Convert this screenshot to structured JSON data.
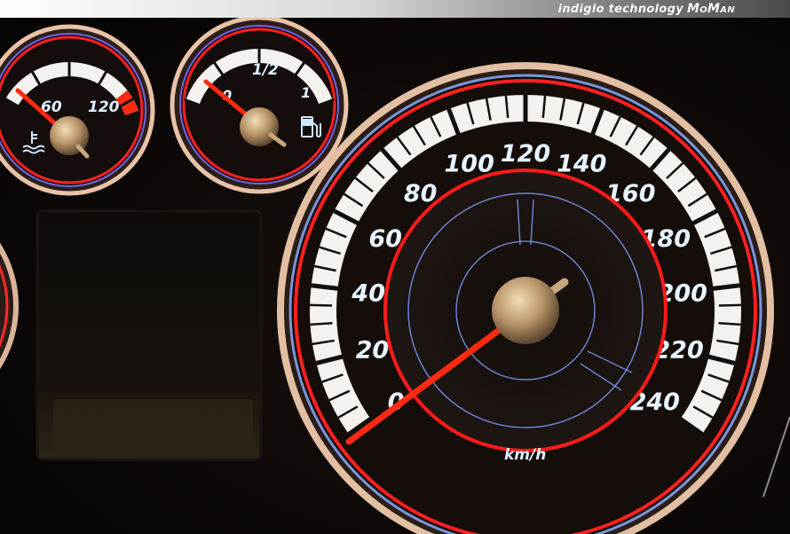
{
  "header": {
    "brand_text": "indiglo technology",
    "brand_strong": "MoMan"
  },
  "speedometer": {
    "labels": [
      "0",
      "20",
      "40",
      "60",
      "80",
      "100",
      "120",
      "140",
      "160",
      "180",
      "200",
      "220",
      "240"
    ],
    "unit": "km/h",
    "needle_value": 0
  },
  "temperature_gauge": {
    "labels": [
      "60",
      "120"
    ]
  },
  "fuel_gauge": {
    "labels": [
      "0",
      "1/2",
      "1"
    ]
  },
  "colors": {
    "dial_face": "#f4f2ee",
    "red_ring": "#ff1a1a",
    "blue_glow": "#8fb6ff",
    "needle": "#ff2a10",
    "hub": "#c8a878",
    "bezel": "#2a1e18"
  }
}
